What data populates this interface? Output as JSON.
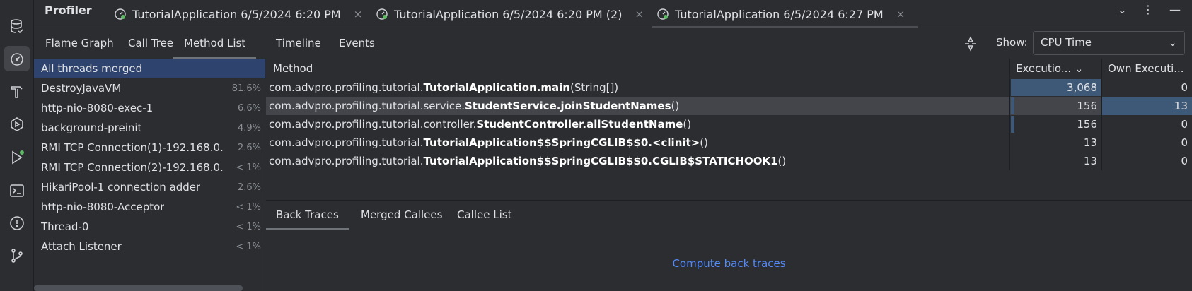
{
  "app": {
    "title": "Profiler",
    "recordings": [
      {
        "label": "TutorialApplication 6/5/2024 6:20 PM",
        "close": "×"
      },
      {
        "label": "TutorialApplication 6/5/2024 6:20 PM (2)",
        "close": "×"
      },
      {
        "label": "TutorialApplication 6/5/2024 6:27 PM",
        "close": "×",
        "selected": true
      }
    ],
    "window_actions": [
      "⌄",
      "⋮",
      "—"
    ]
  },
  "toolstrip": {
    "icons": [
      "database-icon",
      "profiler-gauge-icon",
      "build-hammer-icon",
      "services-icon",
      "run-icon",
      "terminal-icon",
      "problems-icon",
      "git-icon"
    ]
  },
  "view_tabs": [
    "Flame Graph",
    "Call Tree",
    "Method List",
    "Timeline",
    "Events"
  ],
  "show": {
    "label": "Show:",
    "value": "CPU Time"
  },
  "threads": [
    {
      "name": "All threads merged",
      "pct": ""
    },
    {
      "name": "DestroyJavaVM",
      "pct": "81.6%"
    },
    {
      "name": "http-nio-8080-exec-1",
      "pct": "6.6%"
    },
    {
      "name": "background-preinit",
      "pct": "4.9%"
    },
    {
      "name": "RMI TCP Connection(1)-192.168.0.",
      "pct": "2.6%"
    },
    {
      "name": "RMI TCP Connection(2)-192.168.0.",
      "pct": "< 1%"
    },
    {
      "name": "HikariPool-1 connection adder",
      "pct": "2.6%"
    },
    {
      "name": "http-nio-8080-Acceptor",
      "pct": "< 1%"
    },
    {
      "name": "Thread-0",
      "pct": "< 1%"
    },
    {
      "name": "Attach Listener",
      "pct": "< 1%"
    }
  ],
  "table": {
    "headers": {
      "method": "Method",
      "exec": "Executio... ⌄",
      "own": "Own Executi..."
    },
    "rows": [
      {
        "pkg": "com.advpro.profiling.tutorial.",
        "cls": "TutorialApplication.main",
        "args": "(String[])",
        "exec": "3,068",
        "own": "0"
      },
      {
        "pkg": "com.advpro.profiling.tutorial.service.",
        "cls": "StudentService.joinStudentNames",
        "args": "()",
        "exec": "156",
        "own": "13"
      },
      {
        "pkg": "com.advpro.profiling.tutorial.controller.",
        "cls": "StudentController.allStudentName",
        "args": "()",
        "exec": "156",
        "own": "0"
      },
      {
        "pkg": "com.advpro.profiling.tutorial.",
        "cls": "TutorialApplication$$SpringCGLIB$$0.<clinit>",
        "args": "()",
        "exec": "13",
        "own": "0"
      },
      {
        "pkg": "com.advpro.profiling.tutorial.",
        "cls": "TutorialApplication$$SpringCGLIB$$0.CGLIB$STATICHOOK1",
        "args": "()",
        "exec": "13",
        "own": "0"
      }
    ]
  },
  "bottom_tabs": [
    "Back Traces",
    "Merged Callees",
    "Callee List"
  ],
  "compute_link": "Compute back traces"
}
